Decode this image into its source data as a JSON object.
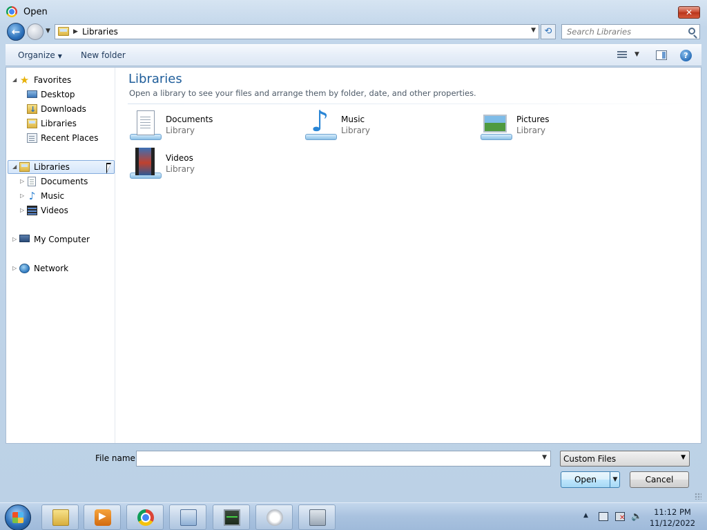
{
  "window": {
    "title": "Open"
  },
  "address": {
    "path_item": "Libraries"
  },
  "search": {
    "placeholder": "Search Libraries"
  },
  "toolbar": {
    "organize_label": "Organize",
    "new_folder_label": "New folder"
  },
  "nav": {
    "favorites": {
      "label": "Favorites",
      "items": [
        "Desktop",
        "Downloads",
        "Libraries",
        "Recent Places"
      ]
    },
    "libraries": {
      "label": "Libraries",
      "items": [
        "Documents",
        "Music",
        "Videos"
      ]
    },
    "computer": {
      "label": "My Computer"
    },
    "network": {
      "label": "Network"
    }
  },
  "main": {
    "title": "Libraries",
    "subtitle": "Open a library to see your files and arrange them by folder, date, and other properties.",
    "libraries": [
      {
        "name": "Documents",
        "type": "Library",
        "icon": "documents-library-icon"
      },
      {
        "name": "Music",
        "type": "Library",
        "icon": "music-library-icon"
      },
      {
        "name": "Pictures",
        "type": "Library",
        "icon": "pictures-library-icon"
      },
      {
        "name": "Videos",
        "type": "Library",
        "icon": "videos-library-icon"
      }
    ]
  },
  "footer": {
    "file_name_label": "File name:",
    "file_name_value": "",
    "filter_value": "Custom Files",
    "open_label": "Open",
    "cancel_label": "Cancel"
  },
  "taskbar": {
    "time": "11:12 PM",
    "date": "11/12/2022",
    "apps": [
      "windows-explorer-icon",
      "media-player-icon",
      "chrome-icon",
      "control-panel-icon",
      "system-monitor-icon",
      "gauge-icon",
      "setup-icon"
    ]
  },
  "colors": {
    "title_accent": "#1e5d9a",
    "selection_border": "#84acdd",
    "close_button": "#c7452c"
  }
}
